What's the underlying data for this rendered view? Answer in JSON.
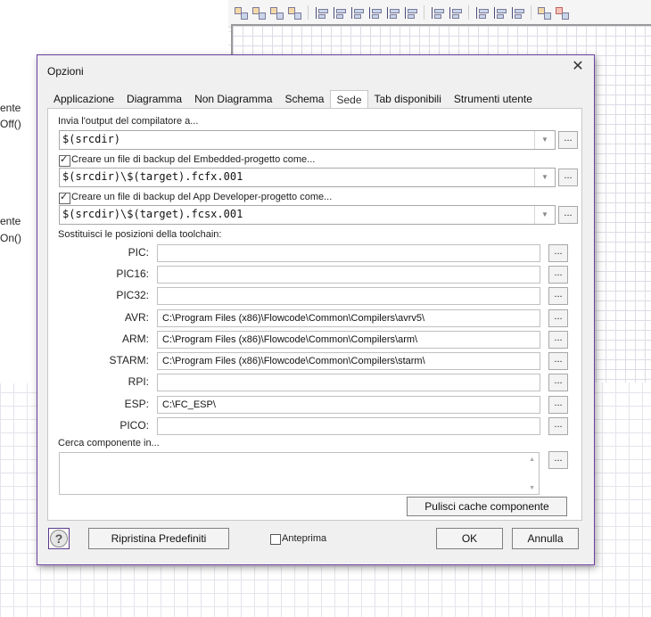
{
  "background": {
    "left_labels": [
      "ente",
      "Off()",
      "ente",
      "On()"
    ]
  },
  "dialog": {
    "title": "Opzioni",
    "tabs": [
      {
        "label": "Applicazione"
      },
      {
        "label": "Diagramma"
      },
      {
        "label": "Non Diagramma"
      },
      {
        "label": "Schema"
      },
      {
        "label": "Sede",
        "active": true
      },
      {
        "label": "Tab disponibili"
      },
      {
        "label": "Strumenti utente"
      }
    ],
    "compiler_output": {
      "label": "Invia l'output del compilatore a...",
      "value": "$(srcdir)"
    },
    "embedded_backup": {
      "checked": true,
      "label": "Creare un file di backup del Embedded-progetto come...",
      "value": "$(srcdir)\\$(target).fcfx.001"
    },
    "appdev_backup": {
      "checked": true,
      "label": "Creare un file di backup del App Developer-progetto come...",
      "value": "$(srcdir)\\$(target).fcsx.001"
    },
    "toolchain_label": "Sostituisci le posizioni della toolchain:",
    "toolchains": [
      {
        "name": "PIC:",
        "path": ""
      },
      {
        "name": "PIC16:",
        "path": ""
      },
      {
        "name": "PIC32:",
        "path": ""
      },
      {
        "name": "AVR:",
        "path": "C:\\Program Files (x86)\\Flowcode\\Common\\Compilers\\avrv5\\"
      },
      {
        "name": "ARM:",
        "path": "C:\\Program Files (x86)\\Flowcode\\Common\\Compilers\\arm\\"
      },
      {
        "name": "STARM:",
        "path": "C:\\Program Files (x86)\\Flowcode\\Common\\Compilers\\starm\\"
      },
      {
        "name": "RPI:",
        "path": ""
      },
      {
        "name": "ESP:",
        "path": "C:\\FC_ESP\\"
      },
      {
        "name": "PICO:",
        "path": ""
      }
    ],
    "component_search_label": "Cerca componente in...",
    "browse_label": "...",
    "clear_cache_label": "Pulisci cache componente",
    "restore_defaults_label": "Ripristina Predefiniti",
    "preview_label": "Anteprima",
    "preview_checked": false,
    "ok_label": "OK",
    "cancel_label": "Annulla"
  }
}
